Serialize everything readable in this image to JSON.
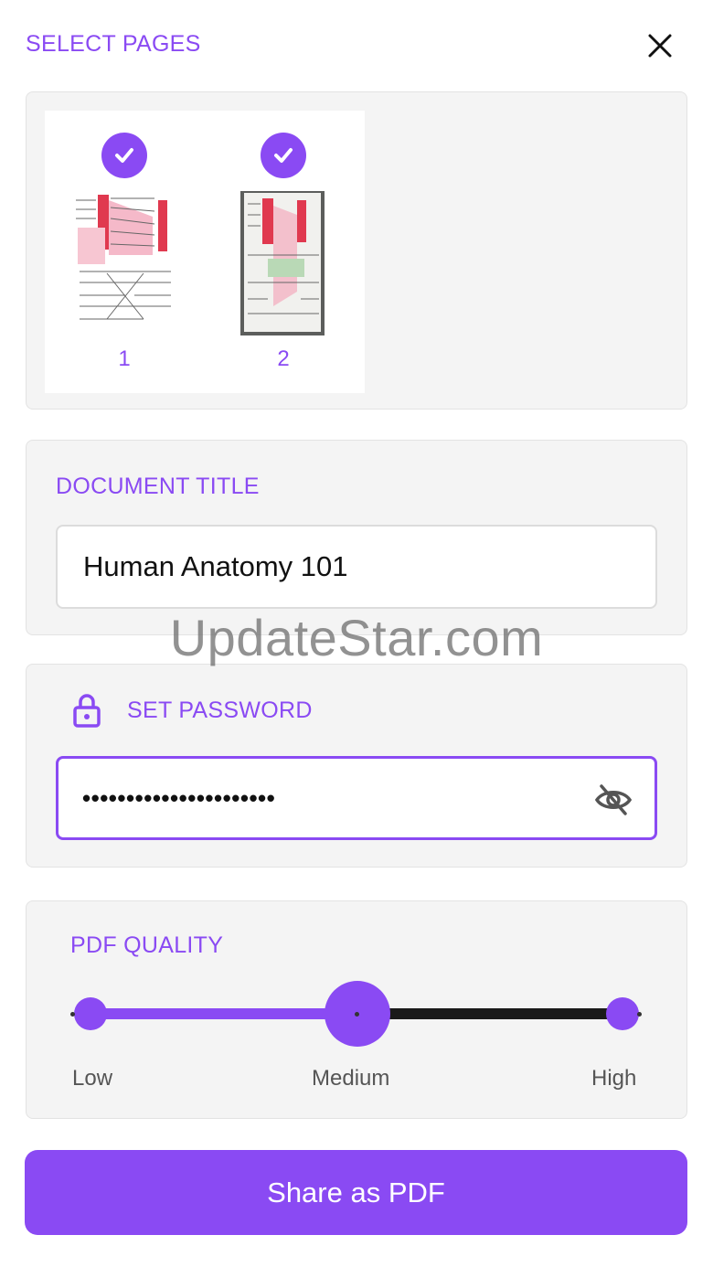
{
  "header": {
    "title": "SELECT PAGES",
    "close_icon": "close-icon"
  },
  "pages": [
    {
      "number": "1",
      "selected": true
    },
    {
      "number": "2",
      "selected": true
    }
  ],
  "document_title": {
    "label": "DOCUMENT TITLE",
    "value": "Human Anatomy 101"
  },
  "password": {
    "label": "SET PASSWORD",
    "masked_value": "••••••••••••••••••••••",
    "icon": "lock-icon",
    "toggle_icon": "eye-slash-icon"
  },
  "quality": {
    "label": "PDF QUALITY",
    "options": [
      "Low",
      "Medium",
      "High"
    ],
    "selected": "Medium"
  },
  "share_button": {
    "label": "Share as PDF"
  },
  "watermark": "UpdateStar.com",
  "colors": {
    "accent": "#8a4af3",
    "card": "#f4f4f4",
    "track_inactive": "#1a1a1a"
  }
}
